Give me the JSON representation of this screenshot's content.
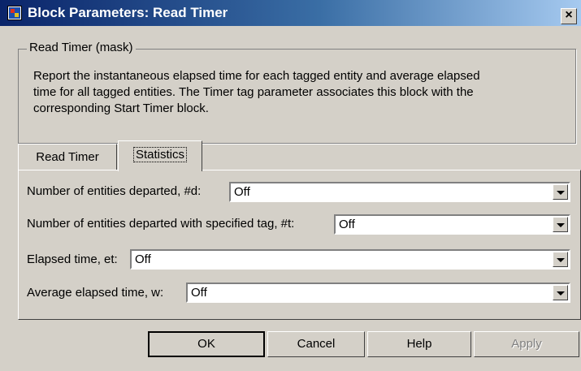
{
  "window": {
    "title": "Block Parameters: Read Timer",
    "close_label": "×"
  },
  "mask": {
    "legend": "Read Timer (mask)",
    "description_lines": [
      "Report the instantaneous elapsed time for each tagged entity and average elapsed",
      "time for all tagged entities. The Timer tag parameter associates this block with the",
      "corresponding Start Timer block."
    ]
  },
  "tabs": [
    {
      "label": "Read Timer",
      "selected": false
    },
    {
      "label": "Statistics",
      "selected": true
    }
  ],
  "params": [
    {
      "label": "Number of entities departed, #d:",
      "value": "Off"
    },
    {
      "label": "Number of entities departed with specified tag, #t:",
      "value": "Off"
    },
    {
      "label": "Elapsed time, et:",
      "value": "Off"
    },
    {
      "label": "Average elapsed time, w:",
      "value": "Off"
    }
  ],
  "buttons": {
    "ok": "OK",
    "cancel": "Cancel",
    "help": "Help",
    "apply": "Apply"
  }
}
